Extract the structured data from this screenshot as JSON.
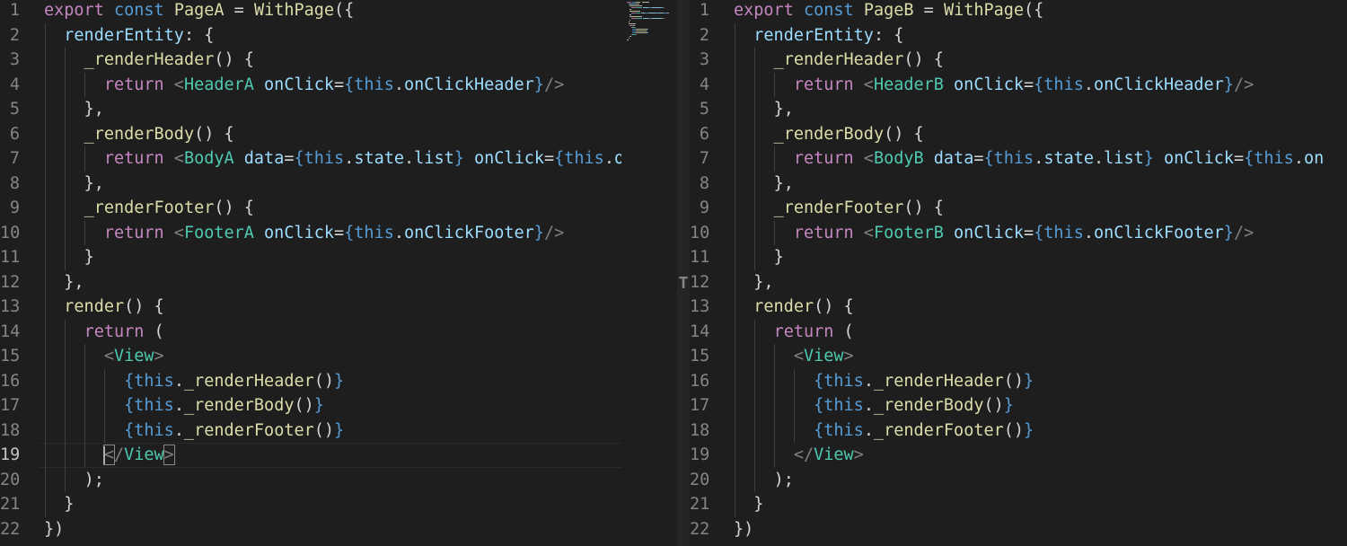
{
  "colors": {
    "background": "#1e1e1e",
    "line_number": "#858585",
    "line_number_active": "#c6c6c6",
    "keyword": "#c586c0",
    "storage": "#569cd6",
    "function": "#dcdcaa",
    "component": "#4ec9b0",
    "property": "#9cdcfe",
    "tag_bracket": "#808080",
    "plain": "#d4d4d4"
  },
  "editor_left": {
    "active_line": 19,
    "lines": [
      {
        "n": "1",
        "indent": 0,
        "tokens": [
          [
            "kw",
            "export"
          ],
          [
            "p",
            " "
          ],
          [
            "st",
            "const"
          ],
          [
            "p",
            " "
          ],
          [
            "fn",
            "PageA"
          ],
          [
            "p",
            " = "
          ],
          [
            "fn",
            "WithPage"
          ],
          [
            "p",
            "({"
          ]
        ]
      },
      {
        "n": "2",
        "indent": 1,
        "tokens": [
          [
            "prop",
            "renderEntity"
          ],
          [
            "p",
            ": {"
          ]
        ]
      },
      {
        "n": "3",
        "indent": 2,
        "tokens": [
          [
            "fn",
            "_renderHeader"
          ],
          [
            "p",
            "() {"
          ]
        ]
      },
      {
        "n": "4",
        "indent": 3,
        "tokens": [
          [
            "kw",
            "return"
          ],
          [
            "p",
            " "
          ],
          [
            "tag",
            "<"
          ],
          [
            "cls",
            "HeaderA"
          ],
          [
            "p",
            " "
          ],
          [
            "prop",
            "onClick"
          ],
          [
            "p",
            "="
          ],
          [
            "br",
            "{"
          ],
          [
            "this",
            "this"
          ],
          [
            "p",
            "."
          ],
          [
            "prop",
            "onClickHeader"
          ],
          [
            "br",
            "}"
          ],
          [
            "tag",
            "/>"
          ]
        ]
      },
      {
        "n": "5",
        "indent": 2,
        "tokens": [
          [
            "p",
            "},"
          ]
        ]
      },
      {
        "n": "6",
        "indent": 2,
        "tokens": [
          [
            "fn",
            "_renderBody"
          ],
          [
            "p",
            "() {"
          ]
        ]
      },
      {
        "n": "7",
        "indent": 3,
        "tokens": [
          [
            "kw",
            "return"
          ],
          [
            "p",
            " "
          ],
          [
            "tag",
            "<"
          ],
          [
            "cls",
            "BodyA"
          ],
          [
            "p",
            " "
          ],
          [
            "prop",
            "data"
          ],
          [
            "p",
            "="
          ],
          [
            "br",
            "{"
          ],
          [
            "this",
            "this"
          ],
          [
            "p",
            "."
          ],
          [
            "prop",
            "state"
          ],
          [
            "p",
            "."
          ],
          [
            "prop",
            "list"
          ],
          [
            "br",
            "}"
          ],
          [
            "p",
            " "
          ],
          [
            "prop",
            "onClick"
          ],
          [
            "p",
            "="
          ],
          [
            "br",
            "{"
          ],
          [
            "this",
            "this"
          ],
          [
            "p",
            "."
          ],
          [
            "prop",
            "o"
          ]
        ]
      },
      {
        "n": "8",
        "indent": 2,
        "tokens": [
          [
            "p",
            "},"
          ]
        ]
      },
      {
        "n": "9",
        "indent": 2,
        "tokens": [
          [
            "fn",
            "_renderFooter"
          ],
          [
            "p",
            "() {"
          ]
        ]
      },
      {
        "n": "10",
        "indent": 3,
        "tokens": [
          [
            "kw",
            "return"
          ],
          [
            "p",
            " "
          ],
          [
            "tag",
            "<"
          ],
          [
            "cls",
            "FooterA"
          ],
          [
            "p",
            " "
          ],
          [
            "prop",
            "onClick"
          ],
          [
            "p",
            "="
          ],
          [
            "br",
            "{"
          ],
          [
            "this",
            "this"
          ],
          [
            "p",
            "."
          ],
          [
            "prop",
            "onClickFooter"
          ],
          [
            "br",
            "}"
          ],
          [
            "tag",
            "/>"
          ]
        ]
      },
      {
        "n": "11",
        "indent": 2,
        "tokens": [
          [
            "p",
            "}"
          ]
        ]
      },
      {
        "n": "12",
        "indent": 1,
        "tokens": [
          [
            "p",
            "},"
          ]
        ]
      },
      {
        "n": "13",
        "indent": 1,
        "tokens": [
          [
            "fn",
            "render"
          ],
          [
            "p",
            "() {"
          ]
        ]
      },
      {
        "n": "14",
        "indent": 2,
        "tokens": [
          [
            "kw",
            "return"
          ],
          [
            "p",
            " ("
          ]
        ]
      },
      {
        "n": "15",
        "indent": 3,
        "tokens": [
          [
            "tag",
            "<"
          ],
          [
            "cls",
            "View"
          ],
          [
            "tag",
            ">"
          ]
        ]
      },
      {
        "n": "16",
        "indent": 4,
        "tokens": [
          [
            "br",
            "{"
          ],
          [
            "this",
            "this"
          ],
          [
            "p",
            "."
          ],
          [
            "fn",
            "_renderHeader"
          ],
          [
            "p",
            "()"
          ],
          [
            "br",
            "}"
          ]
        ]
      },
      {
        "n": "17",
        "indent": 4,
        "tokens": [
          [
            "br",
            "{"
          ],
          [
            "this",
            "this"
          ],
          [
            "p",
            "."
          ],
          [
            "fn",
            "_renderBody"
          ],
          [
            "p",
            "()"
          ],
          [
            "br",
            "}"
          ]
        ]
      },
      {
        "n": "18",
        "indent": 4,
        "tokens": [
          [
            "br",
            "{"
          ],
          [
            "this",
            "this"
          ],
          [
            "p",
            "."
          ],
          [
            "fn",
            "_renderFooter"
          ],
          [
            "p",
            "()"
          ],
          [
            "br",
            "}"
          ]
        ]
      },
      {
        "n": "19",
        "indent": 3,
        "tokens": [
          [
            "tagbox",
            "<"
          ],
          [
            "tag",
            "/"
          ],
          [
            "cls",
            "View"
          ],
          [
            "tagbox",
            ">"
          ]
        ]
      },
      {
        "n": "20",
        "indent": 2,
        "tokens": [
          [
            "p",
            ");"
          ]
        ]
      },
      {
        "n": "21",
        "indent": 1,
        "tokens": [
          [
            "p",
            "}"
          ]
        ]
      },
      {
        "n": "22",
        "indent": 0,
        "tokens": [
          [
            "p",
            "})"
          ]
        ]
      }
    ]
  },
  "editor_right": {
    "active_line": 0,
    "lines": [
      {
        "n": "1",
        "indent": 0,
        "tokens": [
          [
            "kw",
            "export"
          ],
          [
            "p",
            " "
          ],
          [
            "st",
            "const"
          ],
          [
            "p",
            " "
          ],
          [
            "fn",
            "PageB"
          ],
          [
            "p",
            " = "
          ],
          [
            "fn",
            "WithPage"
          ],
          [
            "p",
            "({"
          ]
        ]
      },
      {
        "n": "2",
        "indent": 1,
        "tokens": [
          [
            "prop",
            "renderEntity"
          ],
          [
            "p",
            ": {"
          ]
        ]
      },
      {
        "n": "3",
        "indent": 2,
        "tokens": [
          [
            "fn",
            "_renderHeader"
          ],
          [
            "p",
            "() {"
          ]
        ]
      },
      {
        "n": "4",
        "indent": 3,
        "tokens": [
          [
            "kw",
            "return"
          ],
          [
            "p",
            " "
          ],
          [
            "tag",
            "<"
          ],
          [
            "cls",
            "HeaderB"
          ],
          [
            "p",
            " "
          ],
          [
            "prop",
            "onClick"
          ],
          [
            "p",
            "="
          ],
          [
            "br",
            "{"
          ],
          [
            "this",
            "this"
          ],
          [
            "p",
            "."
          ],
          [
            "prop",
            "onClickHeader"
          ],
          [
            "br",
            "}"
          ],
          [
            "tag",
            "/>"
          ]
        ]
      },
      {
        "n": "5",
        "indent": 2,
        "tokens": [
          [
            "p",
            "},"
          ]
        ]
      },
      {
        "n": "6",
        "indent": 2,
        "tokens": [
          [
            "fn",
            "_renderBody"
          ],
          [
            "p",
            "() {"
          ]
        ]
      },
      {
        "n": "7",
        "indent": 3,
        "tokens": [
          [
            "kw",
            "return"
          ],
          [
            "p",
            " "
          ],
          [
            "tag",
            "<"
          ],
          [
            "cls",
            "BodyB"
          ],
          [
            "p",
            " "
          ],
          [
            "prop",
            "data"
          ],
          [
            "p",
            "="
          ],
          [
            "br",
            "{"
          ],
          [
            "this",
            "this"
          ],
          [
            "p",
            "."
          ],
          [
            "prop",
            "state"
          ],
          [
            "p",
            "."
          ],
          [
            "prop",
            "list"
          ],
          [
            "br",
            "}"
          ],
          [
            "p",
            " "
          ],
          [
            "prop",
            "onClick"
          ],
          [
            "p",
            "="
          ],
          [
            "br",
            "{"
          ],
          [
            "this",
            "this"
          ],
          [
            "p",
            "."
          ],
          [
            "prop",
            "on"
          ]
        ]
      },
      {
        "n": "8",
        "indent": 2,
        "tokens": [
          [
            "p",
            "},"
          ]
        ]
      },
      {
        "n": "9",
        "indent": 2,
        "tokens": [
          [
            "fn",
            "_renderFooter"
          ],
          [
            "p",
            "() {"
          ]
        ]
      },
      {
        "n": "10",
        "indent": 3,
        "tokens": [
          [
            "kw",
            "return"
          ],
          [
            "p",
            " "
          ],
          [
            "tag",
            "<"
          ],
          [
            "cls",
            "FooterB"
          ],
          [
            "p",
            " "
          ],
          [
            "prop",
            "onClick"
          ],
          [
            "p",
            "="
          ],
          [
            "br",
            "{"
          ],
          [
            "this",
            "this"
          ],
          [
            "p",
            "."
          ],
          [
            "prop",
            "onClickFooter"
          ],
          [
            "br",
            "}"
          ],
          [
            "tag",
            "/>"
          ]
        ]
      },
      {
        "n": "11",
        "indent": 2,
        "tokens": [
          [
            "p",
            "}"
          ]
        ]
      },
      {
        "n": "12",
        "indent": 1,
        "tokens": [
          [
            "p",
            "},"
          ]
        ]
      },
      {
        "n": "13",
        "indent": 1,
        "tokens": [
          [
            "fn",
            "render"
          ],
          [
            "p",
            "() {"
          ]
        ]
      },
      {
        "n": "14",
        "indent": 2,
        "tokens": [
          [
            "kw",
            "return"
          ],
          [
            "p",
            " ("
          ]
        ]
      },
      {
        "n": "15",
        "indent": 3,
        "tokens": [
          [
            "tag",
            "<"
          ],
          [
            "cls",
            "View"
          ],
          [
            "tag",
            ">"
          ]
        ]
      },
      {
        "n": "16",
        "indent": 4,
        "tokens": [
          [
            "br",
            "{"
          ],
          [
            "this",
            "this"
          ],
          [
            "p",
            "."
          ],
          [
            "fn",
            "_renderHeader"
          ],
          [
            "p",
            "()"
          ],
          [
            "br",
            "}"
          ]
        ]
      },
      {
        "n": "17",
        "indent": 4,
        "tokens": [
          [
            "br",
            "{"
          ],
          [
            "this",
            "this"
          ],
          [
            "p",
            "."
          ],
          [
            "fn",
            "_renderBody"
          ],
          [
            "p",
            "()"
          ],
          [
            "br",
            "}"
          ]
        ]
      },
      {
        "n": "18",
        "indent": 4,
        "tokens": [
          [
            "br",
            "{"
          ],
          [
            "this",
            "this"
          ],
          [
            "p",
            "."
          ],
          [
            "fn",
            "_renderFooter"
          ],
          [
            "p",
            "()"
          ],
          [
            "br",
            "}"
          ]
        ]
      },
      {
        "n": "19",
        "indent": 3,
        "tokens": [
          [
            "tag",
            "</"
          ],
          [
            "cls",
            "View"
          ],
          [
            "tag",
            ">"
          ]
        ]
      },
      {
        "n": "20",
        "indent": 2,
        "tokens": [
          [
            "p",
            ");"
          ]
        ]
      },
      {
        "n": "21",
        "indent": 1,
        "tokens": [
          [
            "p",
            "}"
          ]
        ]
      },
      {
        "n": "22",
        "indent": 0,
        "tokens": [
          [
            "p",
            "})"
          ]
        ]
      }
    ]
  },
  "splitter": {
    "handle_glyph": "T"
  }
}
